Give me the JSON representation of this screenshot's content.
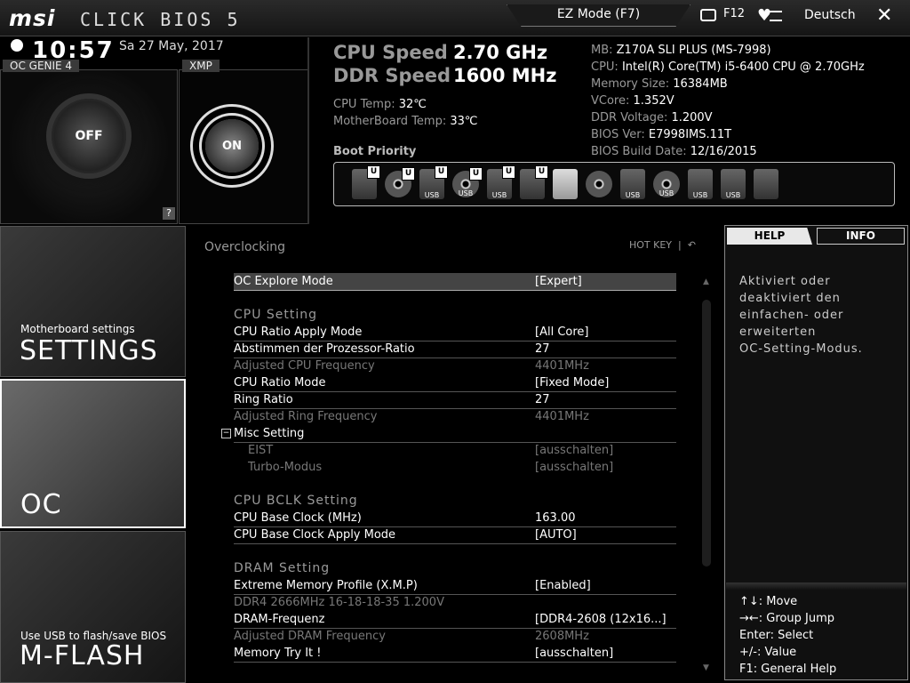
{
  "header": {
    "logo": "msi",
    "product": "CLICK BIOS 5",
    "ez_mode_label": "EZ Mode (F7)",
    "screenshot_key": "F12",
    "language": "Deutsch",
    "close_symbol": "✕"
  },
  "status": {
    "time": "10:57",
    "date": "Sa 27 May, 2017",
    "oc_genie_label": "OC GENIE 4",
    "oc_genie_state": "OFF",
    "xmp_label": "XMP",
    "xmp_state": "ON",
    "help_symbol": "?"
  },
  "cpu": {
    "cpu_speed_label": "CPU Speed",
    "cpu_speed_value": "2.70 GHz",
    "ddr_speed_label": "DDR Speed",
    "ddr_speed_value": "1600 MHz",
    "cpu_temp_label": "CPU Temp:",
    "cpu_temp_value": "32℃",
    "mb_temp_label": "MotherBoard Temp:",
    "mb_temp_value": "33℃"
  },
  "sysinfo": [
    {
      "label": "MB:",
      "value": "Z170A SLI PLUS (MS-7998)"
    },
    {
      "label": "CPU:",
      "value": "Intel(R) Core(TM) i5-6400 CPU @ 2.70GHz"
    },
    {
      "label": "Memory Size:",
      "value": "16384MB"
    },
    {
      "label": "VCore:",
      "value": "1.352V"
    },
    {
      "label": "DDR Voltage:",
      "value": "1.200V"
    },
    {
      "label": "BIOS Ver:",
      "value": "E7998IMS.11T"
    },
    {
      "label": "BIOS Build Date:",
      "value": "12/16/2015"
    }
  ],
  "boot": {
    "title": "Boot Priority",
    "devices": [
      {
        "icon": "hdd-icon",
        "badge": "U",
        "text": ""
      },
      {
        "icon": "disc-icon",
        "badge": "U",
        "text": ""
      },
      {
        "icon": "usb-hdd-icon",
        "badge": "U",
        "text": "USB"
      },
      {
        "icon": "usb-disc-icon",
        "badge": "U",
        "text": "USB"
      },
      {
        "icon": "usb-key-icon",
        "badge": "U",
        "text": "USB"
      },
      {
        "icon": "floppy-icon",
        "badge": "U",
        "text": ""
      },
      {
        "icon": "hdd-icon",
        "badge": "",
        "text": ""
      },
      {
        "icon": "disc-icon",
        "badge": "",
        "text": ""
      },
      {
        "icon": "usb-hdd-icon",
        "badge": "",
        "text": "USB"
      },
      {
        "icon": "usb-disc-icon",
        "badge": "",
        "text": "USB"
      },
      {
        "icon": "usb-key-icon",
        "badge": "",
        "text": "USB"
      },
      {
        "icon": "usb-floppy-icon",
        "badge": "",
        "text": "USB"
      },
      {
        "icon": "network-icon",
        "badge": "",
        "text": ""
      }
    ]
  },
  "nav": {
    "settings_sub": "Motherboard settings",
    "settings_label": "SETTINGS",
    "oc_label": "OC",
    "mflash_sub": "Use USB to flash/save BIOS",
    "mflash_label": "M-FLASH"
  },
  "main": {
    "title": "Overclocking",
    "hotkey_label": "HOT KEY",
    "hotkey_sep": "|",
    "back_symbol": "↶",
    "rows": [
      {
        "type": "act sel",
        "label": "OC Explore Mode",
        "value": "[Expert]"
      },
      {
        "type": "head",
        "label": "CPU  Setting",
        "value": ""
      },
      {
        "type": "act",
        "label": "CPU Ratio Apply Mode",
        "value": "[All Core]"
      },
      {
        "type": "act",
        "label": "Abstimmen der Prozessor-Ratio",
        "value": "27"
      },
      {
        "type": "dim",
        "label": "Adjusted CPU Frequency",
        "value": "4401MHz"
      },
      {
        "type": "act",
        "label": "CPU Ratio Mode",
        "value": "[Fixed Mode]"
      },
      {
        "type": "act",
        "label": "Ring Ratio",
        "value": "27"
      },
      {
        "type": "dim",
        "label": "Adjusted Ring Frequency",
        "value": "4401MHz"
      },
      {
        "type": "act coll",
        "label": "Misc Setting",
        "value": ""
      },
      {
        "type": "dim sub",
        "label": "EIST",
        "value": "[ausschalten]"
      },
      {
        "type": "dim sub",
        "label": "Turbo-Modus",
        "value": "[ausschalten]"
      },
      {
        "type": "head",
        "label": "CPU  BCLK  Setting",
        "value": ""
      },
      {
        "type": "act",
        "label": "CPU Base Clock (MHz)",
        "value": "163.00"
      },
      {
        "type": "act",
        "label": "CPU Base Clock Apply Mode",
        "value": "[AUTO]"
      },
      {
        "type": "head",
        "label": "DRAM  Setting",
        "value": ""
      },
      {
        "type": "act",
        "label": "Extreme Memory Profile (X.M.P)",
        "value": "[Enabled]"
      },
      {
        "type": "dim",
        "label": "DDR4 2666MHz 16-18-18-35 1.200V",
        "value": ""
      },
      {
        "type": "act",
        "label": "DRAM-Frequenz",
        "value": "[DDR4-2608 (12x16...]"
      },
      {
        "type": "dim",
        "label": "Adjusted DRAM Frequency",
        "value": "2608MHz"
      },
      {
        "type": "act",
        "label": "Memory Try It !",
        "value": "[ausschalten]"
      }
    ]
  },
  "help": {
    "tab_help": "HELP",
    "tab_info": "INFO",
    "lines": [
      "Aktiviert oder",
      "deaktiviert den",
      "einfachen- oder",
      "erweiterten",
      "OC-Setting-Modus."
    ],
    "keys": [
      "↑↓: Move",
      "→←: Group Jump",
      "Enter: Select",
      "+/-: Value",
      "F1: General Help"
    ]
  }
}
